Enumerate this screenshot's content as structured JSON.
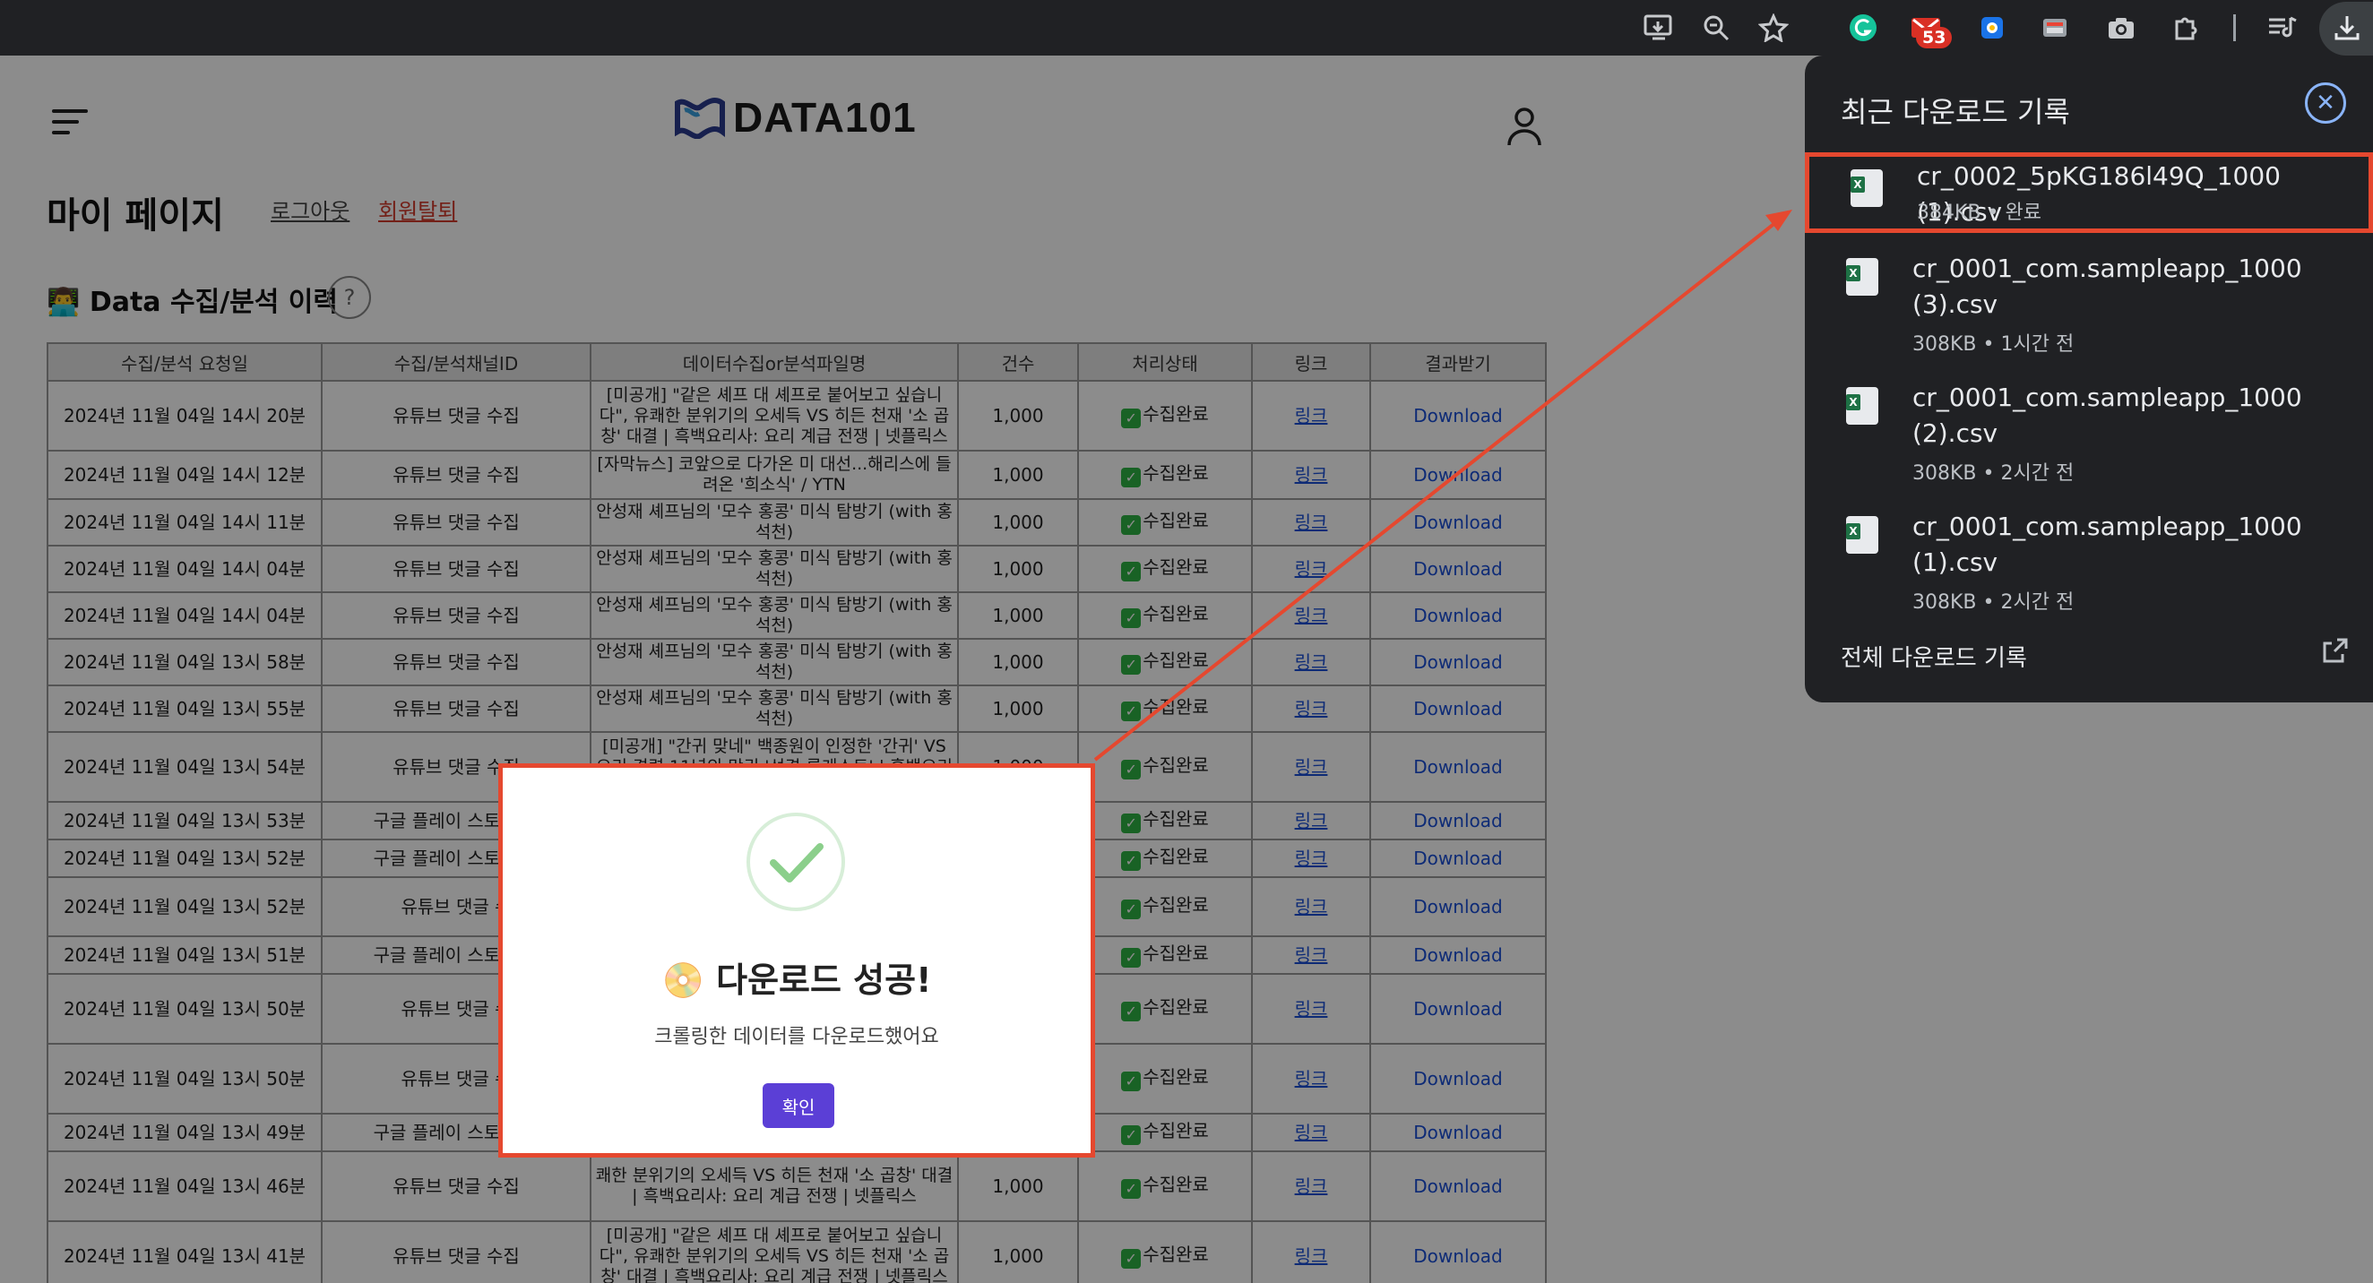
{
  "browser": {
    "mail_badge": "53",
    "toolbar_icons": [
      "install-app-icon",
      "zoom-icon",
      "bookmark-star-icon",
      "grammarly-icon",
      "mail-icon",
      "extension-icon",
      "extension-icon",
      "camera-icon",
      "puzzle-icon",
      "media-icon",
      "download-icon"
    ]
  },
  "site": {
    "logo_text": "DATA101"
  },
  "page": {
    "title": "마이 페이지",
    "logout": "로그아웃",
    "withdraw": "회원탈퇴",
    "section_emoji": "👨‍💻",
    "section_title": "Data 수집/분석 이력",
    "help": "?"
  },
  "table": {
    "headers": [
      "수집/분석 요청일",
      "수집/분석채널ID",
      "데이터수집or분석파일명",
      "건수",
      "처리상태",
      "링크",
      "결과받기"
    ],
    "rows": [
      {
        "date": "2024년 11월 04일 14시 20분",
        "channel": "유튜브 댓글 수집",
        "name": "[미공개] \"같은 셰프 대 셰프로 붙어보고 싶습니다\", 유쾌한 분위기의 오세득 VS 히든 천재 '소 곱창' 대결 | 흑백요리사: 요리 계급 전쟁 | 넷플릭스",
        "count": "1,000",
        "status": "수집완료",
        "link": "링크",
        "download": "Download"
      },
      {
        "date": "2024년 11월 04일 14시 12분",
        "channel": "유튜브 댓글 수집",
        "name": "[자막뉴스] 코앞으로 다가온 미 대선...해리스에 들려온 '희소식' / YTN",
        "count": "1,000",
        "status": "수집완료",
        "link": "링크",
        "download": "Download"
      },
      {
        "date": "2024년 11월 04일 14시 11분",
        "channel": "유튜브 댓글 수집",
        "name": "안성재 셰프님의 '모수 홍콩' 미식 탐방기 (with 홍석천)",
        "count": "1,000",
        "status": "수집완료",
        "link": "링크",
        "download": "Download"
      },
      {
        "date": "2024년 11월 04일 14시 04분",
        "channel": "유튜브 댓글 수집",
        "name": "안성재 셰프님의 '모수 홍콩' 미식 탐방기 (with 홍석천)",
        "count": "1,000",
        "status": "수집완료",
        "link": "링크",
        "download": "Download"
      },
      {
        "date": "2024년 11월 04일 14시 04분",
        "channel": "유튜브 댓글 수집",
        "name": "안성재 셰프님의 '모수 홍콩' 미식 탐방기 (with 홍석천)",
        "count": "1,000",
        "status": "수집완료",
        "link": "링크",
        "download": "Download"
      },
      {
        "date": "2024년 11월 04일 13시 58분",
        "channel": "유튜브 댓글 수집",
        "name": "안성재 셰프님의 '모수 홍콩' 미식 탐방기 (with 홍석천)",
        "count": "1,000",
        "status": "수집완료",
        "link": "링크",
        "download": "Download"
      },
      {
        "date": "2024년 11월 04일 13시 55분",
        "channel": "유튜브 댓글 수집",
        "name": "안성재 셰프님의 '모수 홍콩' 미식 탐방기 (with 홍석천)",
        "count": "1,000",
        "status": "수집완료",
        "link": "링크",
        "download": "Download"
      },
      {
        "date": "2024년 11월 04일 13시 54분",
        "channel": "유튜브 댓글 수집",
        "name": "[미공개] \"간귀 맞네\" 백종원이 인정한 '간귀' VS 요리 경력 11년의 맛귀 '선경 롱게스트' | 흑백요리사: 요리 계급 전쟁 | 넷플릭스",
        "count": "1,000",
        "status": "수집완료",
        "link": "링크",
        "download": "Download"
      },
      {
        "date": "2024년 11월 04일 13시 53분",
        "channel": "구글 플레이 스토어 리",
        "name": "",
        "count": "",
        "status": "수집완료",
        "link": "링크",
        "download": "Download"
      },
      {
        "date": "2024년 11월 04일 13시 52분",
        "channel": "구글 플레이 스토어 리",
        "name": "",
        "count": "",
        "status": "수집완료",
        "link": "링크",
        "download": "Download"
      },
      {
        "date": "2024년 11월 04일 13시 52분",
        "channel": "유튜브 댓글 수",
        "name": "",
        "count": "",
        "status": "수집완료",
        "link": "링크",
        "download": "Download"
      },
      {
        "date": "2024년 11월 04일 13시 51분",
        "channel": "구글 플레이 스토어 리",
        "name": "",
        "count": "",
        "status": "수집완료",
        "link": "링크",
        "download": "Download"
      },
      {
        "date": "2024년 11월 04일 13시 50분",
        "channel": "유튜브 댓글 수",
        "name": "",
        "count": "",
        "status": "수집완료",
        "link": "링크",
        "download": "Download"
      },
      {
        "date": "2024년 11월 04일 13시 50분",
        "channel": "유튜브 댓글 수",
        "name": "",
        "count": "",
        "status": "수집완료",
        "link": "링크",
        "download": "Download"
      },
      {
        "date": "2024년 11월 04일 13시 49분",
        "channel": "구글 플레이 스토어 리",
        "name": "",
        "count": "",
        "status": "수집완료",
        "link": "링크",
        "download": "Download"
      },
      {
        "date": "2024년 11월 04일 13시 46분",
        "channel": "유튜브 댓글 수집",
        "name": "쾌한 분위기의 오세득 VS 히든 천재 '소 곱창' 대결 | 흑백요리사: 요리 계급 전쟁 | 넷플릭스",
        "count": "1,000",
        "status": "수집완료",
        "link": "링크",
        "download": "Download"
      },
      {
        "date": "2024년 11월 04일 13시 41분",
        "channel": "유튜브 댓글 수집",
        "name": "[미공개] \"같은 셰프 대 셰프로 붙어보고 싶습니다\", 유쾌한 분위기의 오세득 VS 히든 천재 '소 곱창' 대결 | 흑백요리사: 요리 계급 전쟁 | 넷플릭스",
        "count": "1,000",
        "status": "수집완료",
        "link": "링크",
        "download": "Download"
      },
      {
        "date": "",
        "channel": "",
        "name": "[미공개] \"같은 셰프 대 셰프로 붙어보고 싶습니다\", 유",
        "count": "",
        "status": "",
        "link": "",
        "download": ""
      }
    ]
  },
  "modal": {
    "emoji": "📀",
    "title": "다운로드 성공!",
    "message": "크롤링한 데이터를 다운로드했어요",
    "confirm": "확인"
  },
  "downloads_panel": {
    "title": "최근 다운로드 기록",
    "items": [
      {
        "name": "cr_0002_5pKG186l49Q_1000 (1).csv",
        "meta": "384KB • 완료"
      },
      {
        "name": "cr_0001_com.sampleapp_1000 (3).csv",
        "meta": "308KB • 1시간 전"
      },
      {
        "name": "cr_0001_com.sampleapp_1000 (2).csv",
        "meta": "308KB • 2시간 전"
      },
      {
        "name": "cr_0001_com.sampleapp_1000 (1).csv",
        "meta": "308KB • 2시간 전"
      }
    ],
    "all_link": "전체 다운로드 기록"
  },
  "colors": {
    "annotation_red": "#e5482f",
    "confirm_purple": "#5b3fd6",
    "chrome_dark": "#202124",
    "link_blue": "#1a4fd8"
  }
}
